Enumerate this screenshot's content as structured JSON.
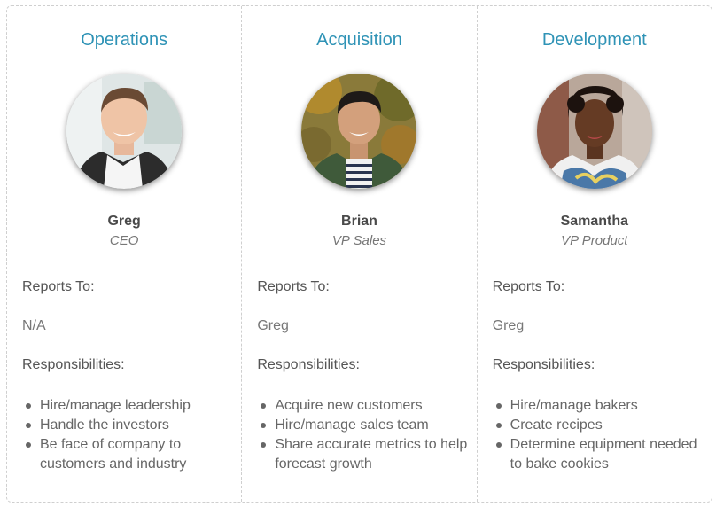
{
  "labels": {
    "reports_to": "Reports To:",
    "responsibilities": "Responsibilities:"
  },
  "colors": {
    "accent": "#2f93b6",
    "border": "#cfcfcf",
    "text": "#555555"
  },
  "columns": [
    {
      "department": "Operations",
      "name": "Greg",
      "role": "CEO",
      "reports_to": "N/A",
      "responsibilities": [
        "Hire/manage leadership",
        "Handle the investors",
        "Be face of company to customers and industry"
      ]
    },
    {
      "department": "Acquisition",
      "name": "Brian",
      "role": "VP Sales",
      "reports_to": "Greg",
      "responsibilities": [
        "Acquire new customers",
        "Hire/manage sales team",
        "Share accurate metrics to help forecast growth"
      ]
    },
    {
      "department": "Development",
      "name": "Samantha",
      "role": "VP Product",
      "reports_to": "Greg",
      "responsibilities": [
        "Hire/manage bakers",
        "Create recipes",
        "Determine equipment needed to bake cookies"
      ]
    }
  ]
}
